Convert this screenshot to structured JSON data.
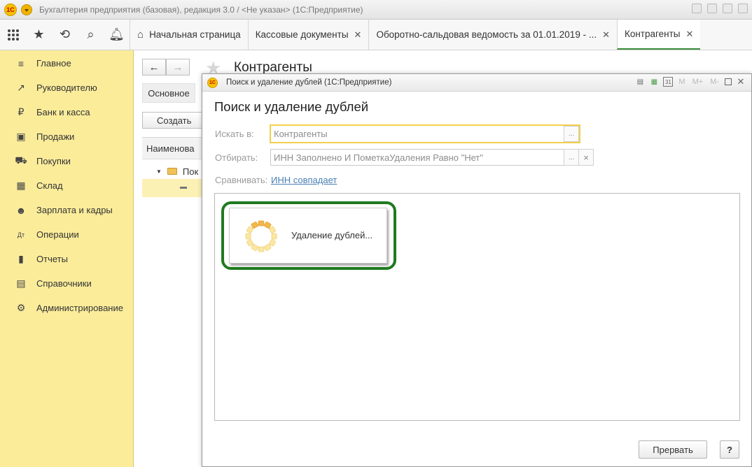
{
  "window": {
    "title": "Бухгалтерия предприятия (базовая), редакция 3.0 / <Не указан>  (1С:Предприятие)",
    "logo": "1С"
  },
  "tabs": [
    {
      "label": "Начальная страница",
      "icon": "home-icon",
      "closable": false,
      "active": false
    },
    {
      "label": "Кассовые документы",
      "closable": true,
      "active": false
    },
    {
      "label": "Оборотно-сальдовая ведомость за 01.01.2019 - ...",
      "closable": true,
      "active": false
    },
    {
      "label": "Контрагенты",
      "closable": true,
      "active": true
    }
  ],
  "sidebar": {
    "items": [
      {
        "label": "Главное",
        "icon": "menu-lines-icon"
      },
      {
        "label": "Руководителю",
        "icon": "trend-up-icon"
      },
      {
        "label": "Банк и касса",
        "icon": "ruble-icon"
      },
      {
        "label": "Продажи",
        "icon": "shopping-bag-icon"
      },
      {
        "label": "Покупки",
        "icon": "cart-icon"
      },
      {
        "label": "Склад",
        "icon": "warehouse-icon"
      },
      {
        "label": "Зарплата и кадры",
        "icon": "people-icon"
      },
      {
        "label": "Операции",
        "icon": "dt-kt-icon"
      },
      {
        "label": "Отчеты",
        "icon": "bar-chart-icon"
      },
      {
        "label": "Справочники",
        "icon": "books-icon"
      },
      {
        "label": "Администрирование",
        "icon": "gear-icon"
      }
    ]
  },
  "background_form": {
    "title": "Контрагенты",
    "main_tab": "Основное",
    "create_button": "Создать",
    "table_header": "Наименова",
    "row1": "Пок"
  },
  "dialog": {
    "window_title": "Поиск и удаление дублей  (1С:Предприятие)",
    "heading": "Поиск и удаление дублей",
    "search_in_label": "Искать в:",
    "search_in_value": "Контрагенты",
    "filter_label": "Отбирать:",
    "filter_value": "ИНН Заполнено И ПометкаУдаления Равно \"Нет\"",
    "compare_label": "Сравнивать:",
    "compare_link": "ИНН совпадает",
    "progress_text": "Удаление дублей...",
    "stop_button": "Прервать",
    "help_button": "?",
    "select_button": "...",
    "clear_button": "×",
    "header_buttons": {
      "m": "M",
      "m_plus": "M+",
      "m_minus": "M-",
      "calendar": "31"
    }
  },
  "colors": {
    "sidebar_bg": "#fbec9a",
    "highlight_ring": "#1f7a1f",
    "link": "#4a7fb5",
    "focus_border": "#f1d04b"
  }
}
